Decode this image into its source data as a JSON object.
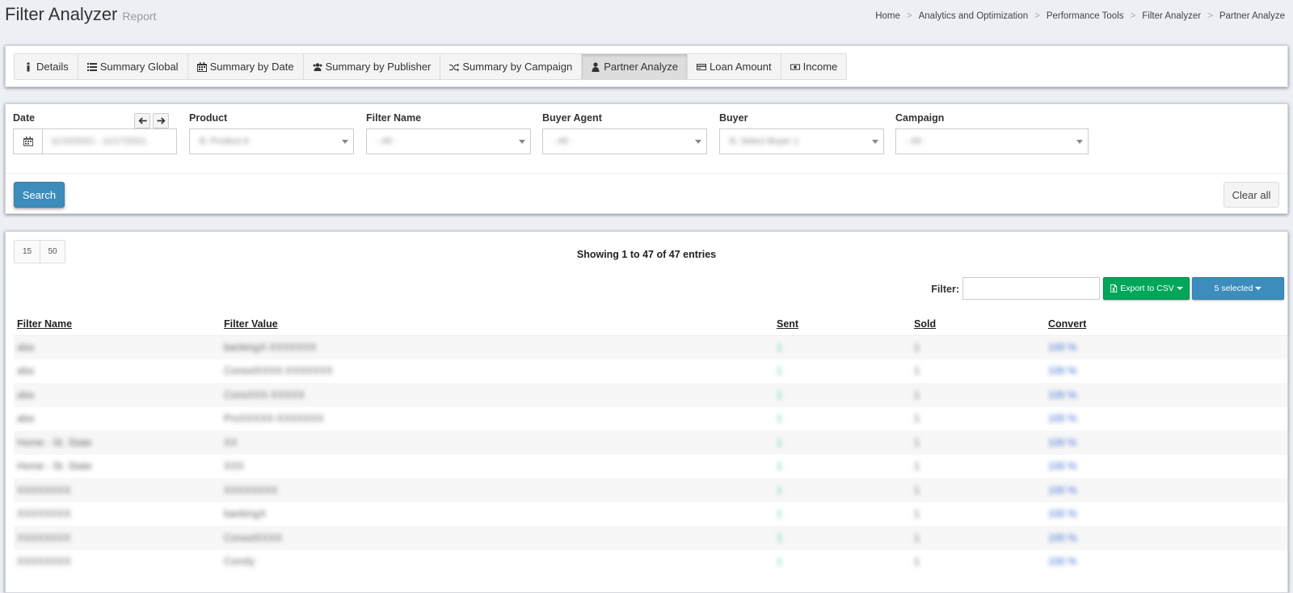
{
  "header": {
    "title": "Filter Analyzer",
    "subtitle": "Report",
    "breadcrumb": [
      "Home",
      "Analytics and Optimization",
      "Performance Tools",
      "Filter Analyzer",
      "Partner Analyze"
    ]
  },
  "tabs": [
    {
      "label": "Details",
      "icon": "info-icon"
    },
    {
      "label": "Summary Global",
      "icon": "list-icon"
    },
    {
      "label": "Summary by Date",
      "icon": "calendar-icon"
    },
    {
      "label": "Summary by Publisher",
      "icon": "users-icon"
    },
    {
      "label": "Summary by Campaign",
      "icon": "shuffle-icon"
    },
    {
      "label": "Partner Analyze",
      "icon": "user-icon",
      "active": true
    },
    {
      "label": "Loan Amount",
      "icon": "credit-card-icon"
    },
    {
      "label": "Income",
      "icon": "money-icon"
    }
  ],
  "filters": {
    "date": {
      "label": "Date",
      "value": "11/10/2021 - 11/17/2021"
    },
    "product": {
      "label": "Product",
      "value": "B. Product A"
    },
    "filter_name": {
      "label": "Filter Name",
      "value": "- All -"
    },
    "buyer_agent": {
      "label": "Buyer Agent",
      "value": "- All -"
    },
    "buyer": {
      "label": "Buyer",
      "value": "B. Select Buyer 1"
    },
    "campaign": {
      "label": "Campaign",
      "value": "- All -"
    },
    "search_label": "Search",
    "clear_label": "Clear all"
  },
  "table_controls": {
    "page_sizes": [
      "15",
      "50"
    ],
    "showing": "Showing 1 to 47 of 47 entries",
    "filter_label": "Filter:",
    "filter_value": "",
    "export_label": "Export to CSV",
    "selected_label": "5 selected"
  },
  "table": {
    "columns": [
      "Filter Name",
      "Filter Value",
      "Sent",
      "Sold",
      "Convert"
    ],
    "rows": [
      [
        "aba",
        "bankingX-XXXXXXX",
        "1",
        "1",
        "100 %"
      ],
      [
        "aba",
        "ConsolXXXX-XXXXXXX",
        "1",
        "1",
        "100 %"
      ],
      [
        "aba",
        "ConsXXX-XXXXX",
        "1",
        "1",
        "100 %"
      ],
      [
        "aba",
        "ProXXXXX-XXXXXXX",
        "1",
        "1",
        "100 %"
      ],
      [
        "Home - St. State",
        "XX",
        "1",
        "1",
        "100 %"
      ],
      [
        "Home - St. State",
        "XXX",
        "1",
        "1",
        "100 %"
      ],
      [
        "XXXXXXXX",
        "XXXXXXXX",
        "1",
        "1",
        "100 %"
      ],
      [
        "XXXXXXXX",
        "bankingX",
        "1",
        "1",
        "100 %"
      ],
      [
        "XXXXXXXX",
        "ConsolXXXX",
        "1",
        "1",
        "100 %"
      ],
      [
        "XXXXXXXX",
        "Consly",
        "1",
        "1",
        "100 %"
      ]
    ]
  }
}
